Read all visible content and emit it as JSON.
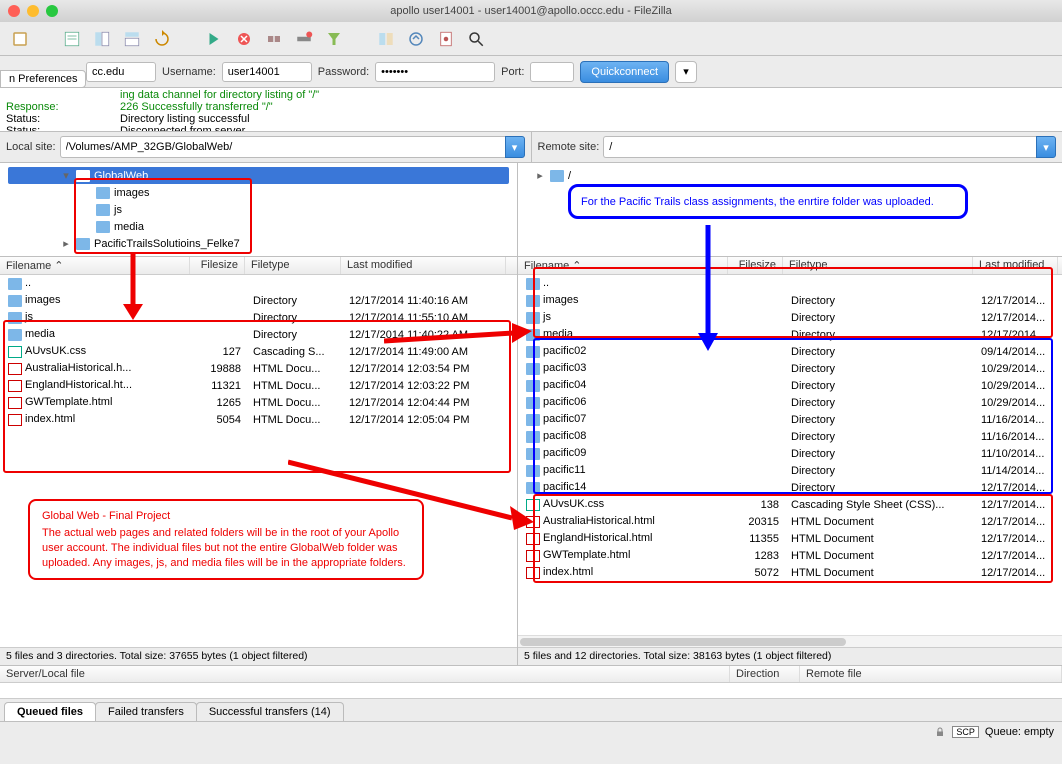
{
  "window": {
    "title": "apollo user14001 - user14001@apollo.occc.edu - FileZilla"
  },
  "prefs_tab": "n Preferences",
  "quickconnect": {
    "host_label": "cc.edu",
    "username_label": "Username:",
    "username": "user14001",
    "password_label": "Password:",
    "password": "•••••••",
    "port_label": "Port:",
    "port": "",
    "button": "Quickconnect",
    "dropdown": "▾"
  },
  "log": [
    {
      "label": "",
      "text": "ing data channel for directory listing of \"/\"",
      "cls": "msg-green",
      "indent": true
    },
    {
      "label": "Response:",
      "text": "226 Successfully transferred \"/\"",
      "cls": "msg-green"
    },
    {
      "label": "Status:",
      "text": "Directory listing successful",
      "cls": ""
    },
    {
      "label": "Status:",
      "text": "Disconnected from server",
      "cls": ""
    }
  ],
  "local": {
    "site_label": "Local site:",
    "path": "/Volumes/AMP_32GB/GlobalWeb/",
    "tree": [
      {
        "indent": 52,
        "expand": "▾",
        "label": "GlobalWeb",
        "sel": true
      },
      {
        "indent": 72,
        "expand": "",
        "label": "images"
      },
      {
        "indent": 72,
        "expand": "",
        "label": "js"
      },
      {
        "indent": 72,
        "expand": "",
        "label": "media"
      },
      {
        "indent": 52,
        "expand": "▸",
        "label": "PacificTrailsSolutioins_Felke7"
      }
    ],
    "headers": {
      "name": "Filename ⌃",
      "size": "Filesize",
      "type": "Filetype",
      "mod": "Last modified"
    },
    "rows": [
      {
        "ico": "fi-folder",
        "name": "..",
        "size": "",
        "type": "",
        "mod": ""
      },
      {
        "ico": "fi-folder",
        "name": "images",
        "size": "",
        "type": "Directory",
        "mod": "12/17/2014 11:40:16 AM"
      },
      {
        "ico": "fi-folder",
        "name": "js",
        "size": "",
        "type": "Directory",
        "mod": "12/17/2014 11:55:10 AM"
      },
      {
        "ico": "fi-folder",
        "name": "media",
        "size": "",
        "type": "Directory",
        "mod": "12/17/2014 11:40:22 AM"
      },
      {
        "ico": "fi-css",
        "name": "AUvsUK.css",
        "size": "127",
        "type": "Cascading S...",
        "mod": "12/17/2014 11:49:00 AM"
      },
      {
        "ico": "fi-html",
        "name": "AustraliaHistorical.h...",
        "size": "19888",
        "type": "HTML Docu...",
        "mod": "12/17/2014 12:03:54 PM"
      },
      {
        "ico": "fi-html",
        "name": "EnglandHistorical.ht...",
        "size": "11321",
        "type": "HTML Docu...",
        "mod": "12/17/2014 12:03:22 PM"
      },
      {
        "ico": "fi-html",
        "name": "GWTemplate.html",
        "size": "1265",
        "type": "HTML Docu...",
        "mod": "12/17/2014 12:04:44 PM"
      },
      {
        "ico": "fi-html",
        "name": "index.html",
        "size": "5054",
        "type": "HTML Docu...",
        "mod": "12/17/2014 12:05:04 PM"
      }
    ],
    "status": "5 files and 3 directories. Total size: 37655 bytes (1 object filtered)"
  },
  "remote": {
    "site_label": "Remote site:",
    "path": "/",
    "tree": [
      {
        "indent": 8,
        "expand": "▸",
        "label": "/",
        "sel": false
      }
    ],
    "headers": {
      "name": "Filename ⌃",
      "size": "Filesize",
      "type": "Filetype",
      "mod": "Last modified"
    },
    "rows": [
      {
        "ico": "fi-folder",
        "name": "..",
        "size": "",
        "type": "",
        "mod": ""
      },
      {
        "ico": "fi-folder",
        "name": "images",
        "size": "",
        "type": "Directory",
        "mod": "12/17/2014..."
      },
      {
        "ico": "fi-folder",
        "name": "js",
        "size": "",
        "type": "Directory",
        "mod": "12/17/2014..."
      },
      {
        "ico": "fi-folder",
        "name": "media",
        "size": "",
        "type": "Directory",
        "mod": "12/17/2014..."
      },
      {
        "ico": "fi-folder",
        "name": "pacific02",
        "size": "",
        "type": "Directory",
        "mod": "09/14/2014..."
      },
      {
        "ico": "fi-folder",
        "name": "pacific03",
        "size": "",
        "type": "Directory",
        "mod": "10/29/2014..."
      },
      {
        "ico": "fi-folder",
        "name": "pacific04",
        "size": "",
        "type": "Directory",
        "mod": "10/29/2014..."
      },
      {
        "ico": "fi-folder",
        "name": "pacific06",
        "size": "",
        "type": "Directory",
        "mod": "10/29/2014..."
      },
      {
        "ico": "fi-folder",
        "name": "pacific07",
        "size": "",
        "type": "Directory",
        "mod": "11/16/2014..."
      },
      {
        "ico": "fi-folder",
        "name": "pacific08",
        "size": "",
        "type": "Directory",
        "mod": "11/16/2014..."
      },
      {
        "ico": "fi-folder",
        "name": "pacific09",
        "size": "",
        "type": "Directory",
        "mod": "11/10/2014..."
      },
      {
        "ico": "fi-folder",
        "name": "pacific11",
        "size": "",
        "type": "Directory",
        "mod": "11/14/2014..."
      },
      {
        "ico": "fi-folder",
        "name": "pacific14",
        "size": "",
        "type": "Directory",
        "mod": "12/17/2014..."
      },
      {
        "ico": "fi-css",
        "name": "AUvsUK.css",
        "size": "138",
        "type": "Cascading Style Sheet (CSS)...",
        "mod": "12/17/2014..."
      },
      {
        "ico": "fi-html",
        "name": "AustraliaHistorical.html",
        "size": "20315",
        "type": "HTML Document",
        "mod": "12/17/2014..."
      },
      {
        "ico": "fi-html",
        "name": "EnglandHistorical.html",
        "size": "11355",
        "type": "HTML Document",
        "mod": "12/17/2014..."
      },
      {
        "ico": "fi-html",
        "name": "GWTemplate.html",
        "size": "1283",
        "type": "HTML Document",
        "mod": "12/17/2014..."
      },
      {
        "ico": "fi-html",
        "name": "index.html",
        "size": "5072",
        "type": "HTML Document",
        "mod": "12/17/2014..."
      }
    ],
    "status": "5 files and 12 directories. Total size: 38163 bytes (1 object filtered)"
  },
  "queue_headers": {
    "local": "Server/Local file",
    "dir": "Direction",
    "remote": "Remote file"
  },
  "tabs": [
    {
      "label": "Queued files",
      "active": true
    },
    {
      "label": "Failed transfers",
      "active": false
    },
    {
      "label": "Successful transfers (14)",
      "active": false
    }
  ],
  "bottom": {
    "badge": "SCP",
    "queue": "Queue: empty"
  },
  "annotations": {
    "blue_callout": "For the Pacific Trails class assignments, the enrtire folder was uploaded.",
    "red_callout_title": "Global Web - Final Project",
    "red_callout_body": "The actual web pages and related folders will be in the root of your Apollo user account. The individual files but not the entire GlobalWeb folder was uploaded. Any images, js, and media files will be in the appropriate folders."
  }
}
